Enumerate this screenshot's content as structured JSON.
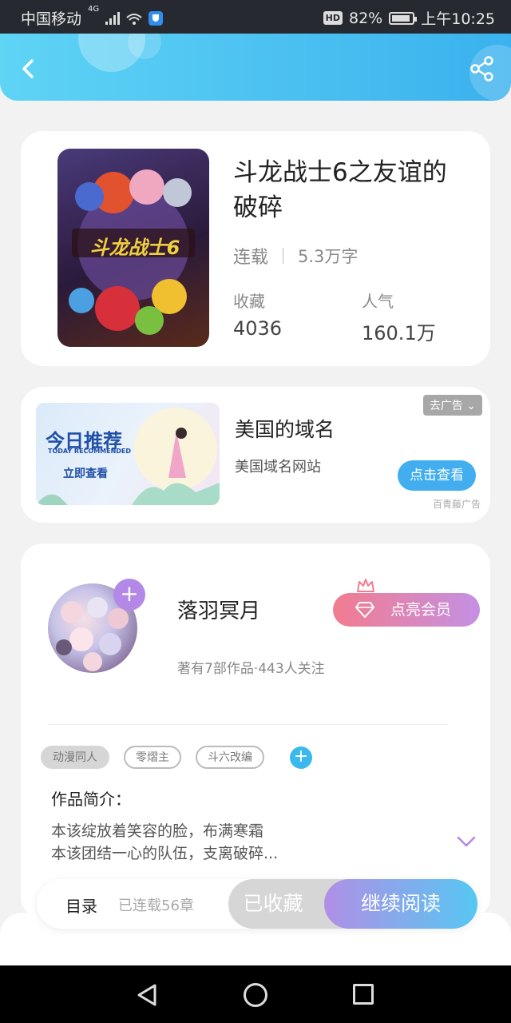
{
  "status_bar": {
    "carrier": "中国移动",
    "network": "4G",
    "battery": "82%",
    "time": "上午10:25"
  },
  "header": {
    "back_icon": "chevron-left-icon",
    "share_icon": "share-icon"
  },
  "book": {
    "title": "斗龙战士6之友谊的破碎",
    "status": "连载",
    "word_count": "5.3万字",
    "favorites_label": "收藏",
    "favorites_value": "4036",
    "popularity_label": "人气",
    "popularity_value": "160.1万",
    "cover_text": "斗龙战士6"
  },
  "ad": {
    "image_title": "今日推荐",
    "image_subtitle": "TODAY RECOMMENDED",
    "image_button": "立即查看",
    "title": "美国的域名",
    "description": "美国域名网站",
    "close_label": "去广告",
    "cta": "点击查看",
    "source": "百青藤广告"
  },
  "author": {
    "name": "落羽冥月",
    "stats": "著有7部作品·443人关注",
    "vip_button": "点亮会员",
    "tags": [
      "动漫同人",
      "零熠主",
      "斗六改编"
    ],
    "intro_heading": "作品简介：",
    "intro_line1": "本该绽放着笑容的脸，布满寒霜",
    "intro_line2": "本该团结一心的队伍，支离破碎..."
  },
  "bottom": {
    "toc": "目录",
    "chapters": "已连载56章",
    "favorited": "已收藏",
    "continue": "继续阅读"
  },
  "colors": {
    "header_start": "#5fd4f5",
    "header_end": "#3bb1ee",
    "accent_blue": "#42aef0",
    "vip_pink": "#f27c8e",
    "vip_purple": "#c490e4"
  }
}
